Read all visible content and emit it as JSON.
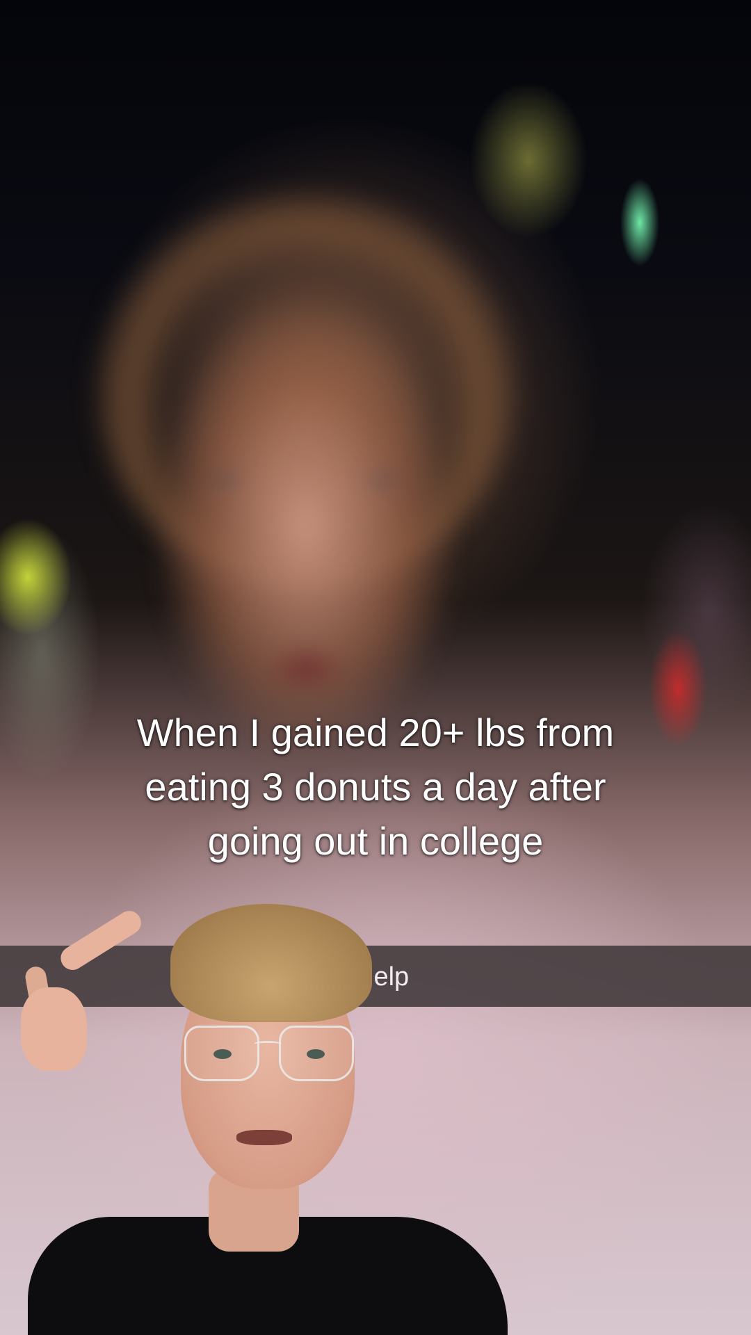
{
  "video": {
    "caption": "When I gained 20+ lbs from\neating 3 donuts a day after\ngoing out in college",
    "search_text": "Help"
  }
}
